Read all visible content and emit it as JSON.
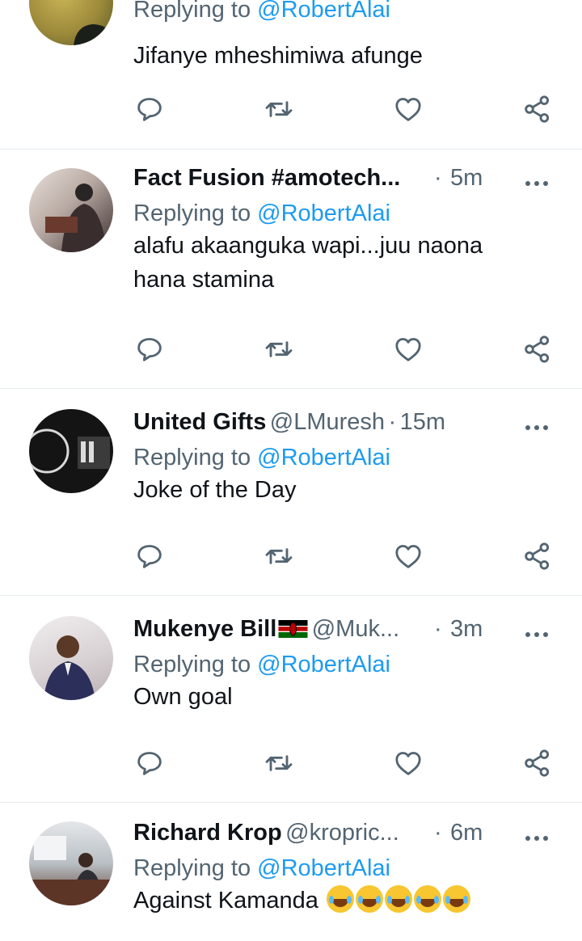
{
  "tweets": [
    {
      "name": "",
      "handle": "",
      "time": "",
      "replying_label": "Replying to",
      "mention": "@RobertAlai",
      "text": "Jifanye mheshimiwa afunge",
      "avatar_colors": [
        "#b7a04a",
        "#6b6a2a"
      ]
    },
    {
      "name": "Fact Fusion #amotech...",
      "handle": "",
      "dot": "·",
      "time": "5m",
      "replying_label": "Replying to",
      "mention": "@RobertAlai",
      "text": "alafu akaanguka wapi...juu naona hana stamina",
      "avatar_colors": [
        "#d9cfc8",
        "#3a3030"
      ]
    },
    {
      "name": "United Gifts",
      "handle": "@LMuresh",
      "dot": "·",
      "time": "15m",
      "replying_label": "Replying to",
      "mention": "@RobertAlai",
      "text": "Joke of the Day",
      "avatar_colors": [
        "#1a1a1a",
        "#4a4a4a"
      ]
    },
    {
      "name": "Mukenye Bill",
      "flag": "kenya-flag-icon",
      "handle": "@Muk...",
      "dot": "·",
      "time": "3m",
      "replying_label": "Replying to",
      "mention": "@RobertAlai",
      "text": "Own goal",
      "avatar_colors": [
        "#e8e4e6",
        "#2a2f55"
      ]
    },
    {
      "name": "Richard Krop",
      "handle": "@kropric...",
      "dot": "·",
      "time": "6m",
      "replying_label": "Replying to",
      "mention": "@RobertAlai",
      "text": "Against Kamanda",
      "emoji": "😂🤣😂🤣😂",
      "avatar_colors": [
        "#cfd3d6",
        "#4a3028"
      ]
    }
  ],
  "icons": {
    "reply": "reply-icon",
    "retweet": "retweet-icon",
    "like": "heart-icon",
    "share": "share-icon",
    "more": "more-icon"
  },
  "colors": {
    "text": "#0f1419",
    "secondary": "#536471",
    "link": "#1d9bf0",
    "divider": "#e6ecf0"
  }
}
